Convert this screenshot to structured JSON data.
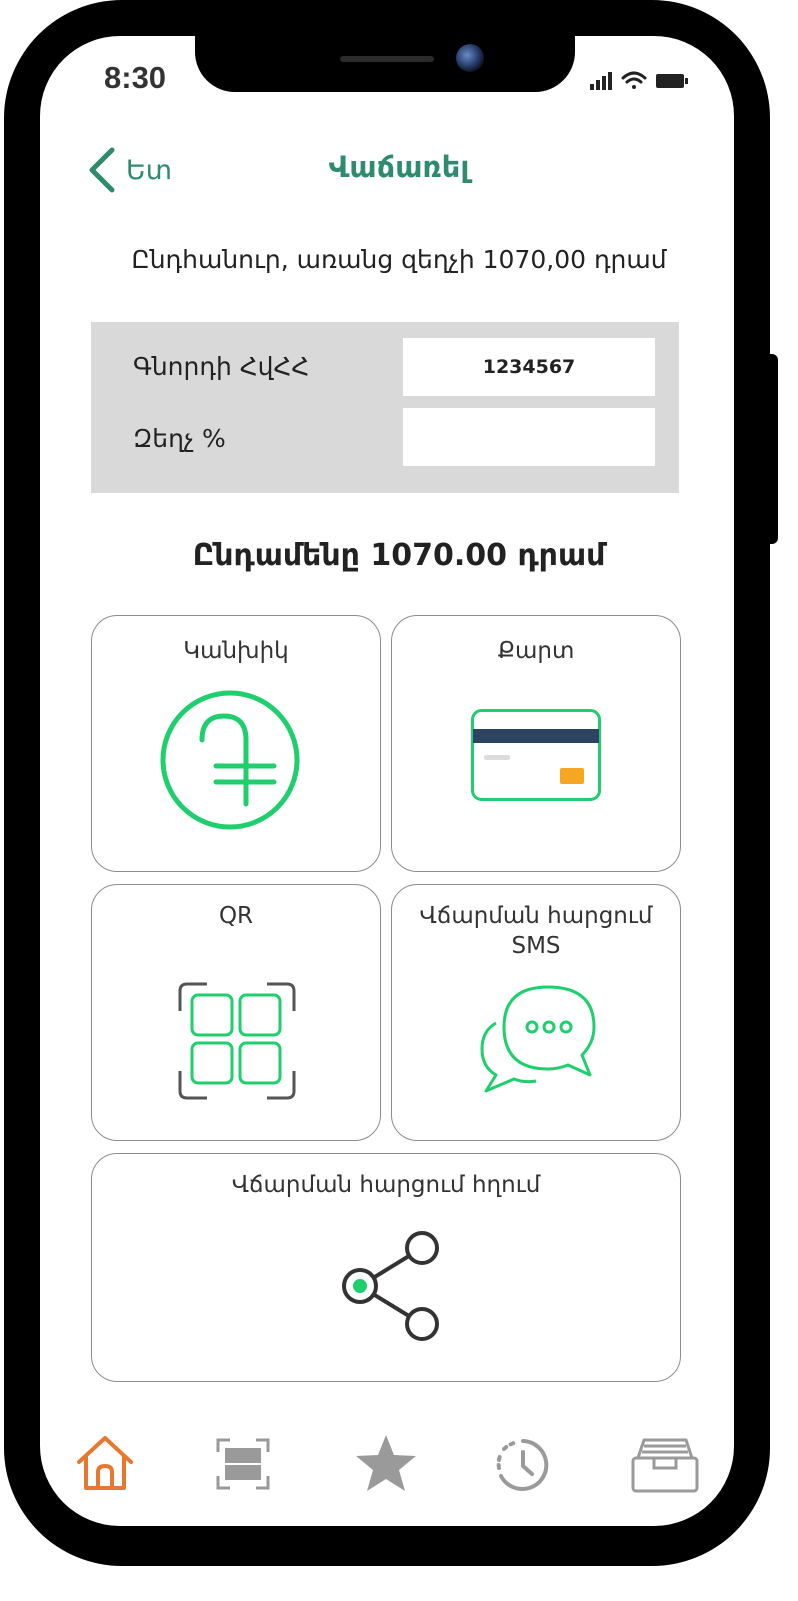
{
  "status_bar": {
    "time": "8:30"
  },
  "header": {
    "back_label": "Ետ",
    "title": "Վաճառել"
  },
  "subtitle": "Ընդհանուր, առանց զեղչի 1070,00 դրամ",
  "form": {
    "buyer_label": "Գնորդի ՀվՀՀ",
    "buyer_value": "1234567",
    "discount_label": "Զեղչ %",
    "discount_value": ""
  },
  "total": "Ընդամենը 1070.00 դրամ",
  "payment_options": {
    "cash": "Կանխիկ",
    "card": "Քարտ",
    "qr": "QR",
    "sms_line1": "Վճարման հարցում",
    "sms_line2": "SMS",
    "link": "Վճարման հարցում հղում"
  },
  "colors": {
    "accent_green": "#1fcf6e",
    "header_green": "#2e8b6e",
    "home_orange": "#e8782e",
    "nav_gray": "#9a9a9a"
  },
  "bottom_nav": [
    "home-icon",
    "scan-icon",
    "star-icon",
    "history-icon",
    "archive-icon"
  ]
}
